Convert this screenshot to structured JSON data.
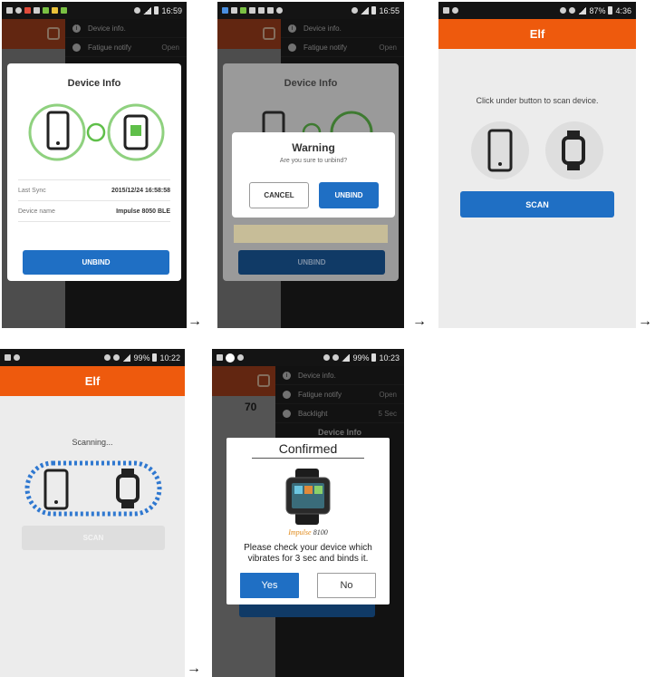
{
  "arrow": "→",
  "screen1": {
    "status_time": "16:59",
    "menu": {
      "device_info": "Device info.",
      "fatigue_notify": "Fatigue notify",
      "fatigue_value": "Open"
    },
    "dialog": {
      "title": "Device Info",
      "rows": [
        {
          "label": "Last Sync",
          "value": "2015/12/24 16:58:58"
        },
        {
          "label": "Device name",
          "value": "Impulse 8050 BLE"
        }
      ],
      "unbind_label": "UNBIND"
    }
  },
  "screen2": {
    "status_time": "16:55",
    "menu": {
      "device_info": "Device info.",
      "fatigue_notify": "Fatigue notify",
      "fatigue_value": "Open"
    },
    "bg_title": "Device Info",
    "bg_unbind_label": "UNBIND",
    "warning": {
      "title": "Warning",
      "message": "Are you sure to unbind?",
      "cancel_label": "CANCEL",
      "unbind_label": "UNBIND"
    }
  },
  "screen3": {
    "status_time": "4:36",
    "status_battery": "87%",
    "app_title": "Elf",
    "instruction": "Click under button to scan device.",
    "scan_label": "SCAN"
  },
  "screen4": {
    "status_time": "10:22",
    "status_battery": "99%",
    "app_title": "Elf",
    "scanning_label": "Scanning...",
    "scan_label": "SCAN"
  },
  "screen5": {
    "status_time": "10:23",
    "status_battery": "99%",
    "bg_number": "70",
    "menu": {
      "device_info": "Device info.",
      "fatigue_notify": "Fatigue notify",
      "fatigue_value": "Open",
      "backlight": "Backlight",
      "backlight_value": "5 Sec",
      "bg_title": "Device Info"
    },
    "confirmed": {
      "title": "Confirmed",
      "brand": "Impulse",
      "model": "8100",
      "message": "Please check your device which vibrates for 3 sec and binds it.",
      "yes_label": "Yes",
      "no_label": "No"
    }
  },
  "colors": {
    "accent_orange": "#ee5a0d",
    "button_blue": "#1f6fc4",
    "device_green": "#5fbf49"
  }
}
